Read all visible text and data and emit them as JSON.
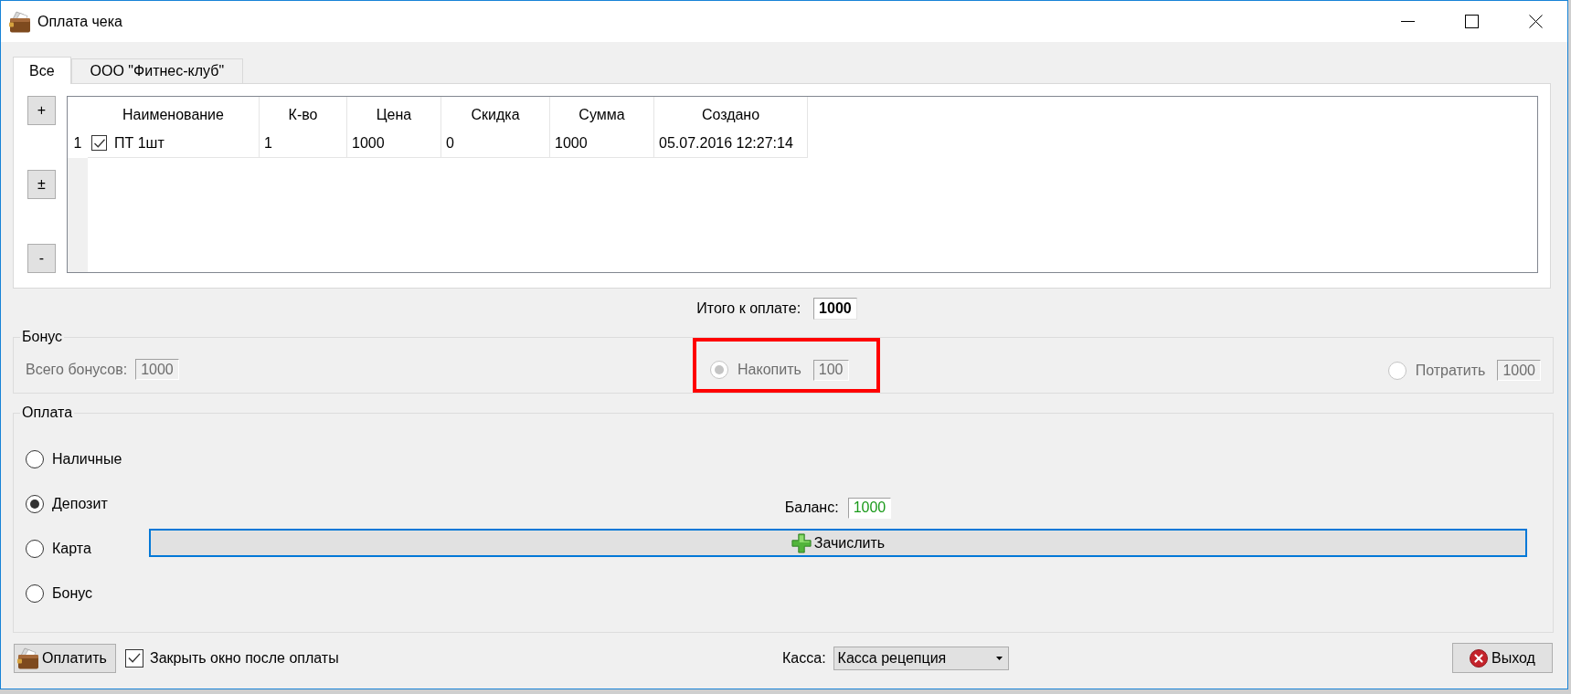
{
  "window": {
    "title": "Оплата чека"
  },
  "tabs": [
    {
      "label": "Все",
      "selected": true
    },
    {
      "label": "ООО \"Фитнес-клуб\"",
      "selected": false
    }
  ],
  "side_buttons": [
    "+",
    "±",
    "-"
  ],
  "table": {
    "columns": [
      "Наименование",
      "К-во",
      "Цена",
      "Скидка",
      "Сумма",
      "Создано"
    ],
    "rows": [
      {
        "number": "1",
        "checked": true,
        "cells": [
          "ПТ 1шт",
          "1",
          "1000",
          "0",
          "1000",
          "05.07.2016 12:27:14"
        ]
      }
    ]
  },
  "total": {
    "label": "Итого к оплате:",
    "value": "1000"
  },
  "bonus": {
    "title": "Бонус",
    "disabled": true,
    "total_label": "Всего бонусов:",
    "total_value": "1000",
    "options": [
      {
        "label": "Накопить",
        "value": "100",
        "selected": true,
        "highlighted": true
      },
      {
        "label": "Потратить",
        "value": "1000",
        "selected": false,
        "highlighted": false
      }
    ]
  },
  "payment": {
    "title": "Оплата",
    "methods": [
      {
        "label": "Наличные",
        "selected": false
      },
      {
        "label": "Депозит",
        "selected": true
      },
      {
        "label": "Карта",
        "selected": false
      },
      {
        "label": "Бонус",
        "selected": false
      }
    ],
    "balance": {
      "label": "Баланс:",
      "value": "1000"
    },
    "credit_button": "Зачислить"
  },
  "footer": {
    "pay_button": "Оплатить",
    "close_after_payment": {
      "label": "Закрыть окно после оплаты",
      "checked": true
    },
    "register": {
      "label": "Касса:",
      "value": "Касса рецепция"
    },
    "exit_button": "Выход"
  }
}
